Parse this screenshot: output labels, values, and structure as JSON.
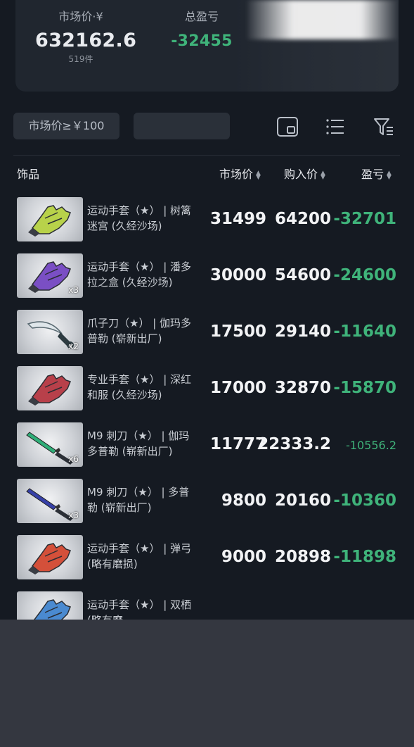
{
  "summary": {
    "market_value_label": "市场价·¥",
    "market_value": "632162.6",
    "item_count": "519件",
    "total_pl_label": "总盈亏",
    "total_pl": "-32455"
  },
  "toolbar": {
    "filter_chip": "市场价≥￥100",
    "icons": [
      "layout-icon",
      "list-icon",
      "filter-icon"
    ]
  },
  "table": {
    "headers": {
      "name": "饰品",
      "market_price": "市场价",
      "buy_price": "购入价",
      "profit_loss": "盈亏"
    },
    "rows": [
      {
        "name": "运动手套（★） | 树篱迷宫 (久经沙场)",
        "qty": "",
        "market_price": "31499",
        "buy_price": "64200",
        "profit_loss": "-32701",
        "thumb_color": "#b8d24a",
        "thumb_kind": "glove"
      },
      {
        "name": "运动手套（★） | 潘多拉之盒 (久经沙场)",
        "qty": "x3",
        "market_price": "30000",
        "buy_price": "54600",
        "profit_loss": "-24600",
        "thumb_color": "#7a4fc4",
        "thumb_kind": "glove"
      },
      {
        "name": "爪子刀（★） | 伽玛多普勒 (崭新出厂)",
        "qty": "x2",
        "market_price": "17500",
        "buy_price": "29140",
        "profit_loss": "-11640",
        "thumb_color": "#4f6f7a",
        "thumb_kind": "karambit"
      },
      {
        "name": "专业手套（★） | 深红和服 (久经沙场)",
        "qty": "",
        "market_price": "17000",
        "buy_price": "32870",
        "profit_loss": "-15870",
        "thumb_color": "#b8404a",
        "thumb_kind": "glove"
      },
      {
        "name": "M9 刺刀（★） | 伽玛多普勒 (崭新出厂)",
        "qty": "x6",
        "market_price": "11777",
        "buy_price": "22333.2",
        "profit_loss": "-10556.2",
        "thumb_color": "#2fae78",
        "thumb_kind": "knife"
      },
      {
        "name": "M9 刺刀（★） | 多普勒 (崭新出厂)",
        "qty": "x3",
        "market_price": "9800",
        "buy_price": "20160",
        "profit_loss": "-10360",
        "thumb_color": "#3640a8",
        "thumb_kind": "knife"
      },
      {
        "name": "运动手套（★） | 弹弓 (略有磨损)",
        "qty": "",
        "market_price": "9000",
        "buy_price": "20898",
        "profit_loss": "-11898",
        "thumb_color": "#d4503a",
        "thumb_kind": "glove"
      },
      {
        "name": "运动手套（★） | 双栖 (略有磨",
        "qty": "",
        "market_price": "",
        "buy_price": "",
        "profit_loss": "",
        "thumb_color": "#4a8ad0",
        "thumb_kind": "glove"
      }
    ]
  }
}
